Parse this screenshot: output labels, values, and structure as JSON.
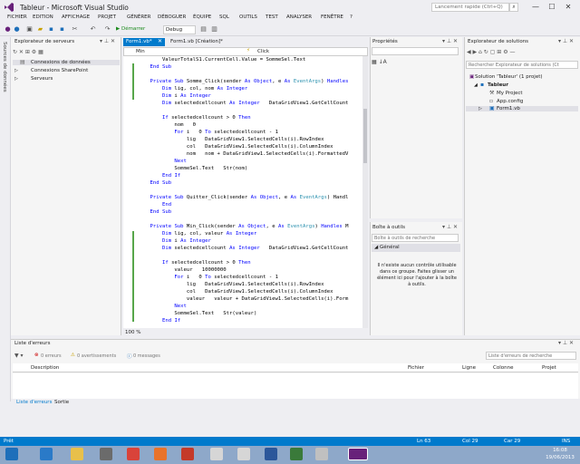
{
  "window": {
    "title": "Tableur - Microsoft Visual Studio",
    "quick_launch_placeholder": "Lancement rapide (Ctrl+Q)",
    "min": "—",
    "max": "☐",
    "close": "✕"
  },
  "menu": [
    "FICHIER",
    "EDITION",
    "AFFICHAGE",
    "PROJET",
    "GÉNÉRER",
    "DÉBOGUER",
    "ÉQUIPE",
    "SQL",
    "OUTILS",
    "TEST",
    "ANALYSER",
    "FENÊTRE",
    "?"
  ],
  "toolbar": {
    "start_label": "▶ Démarrer",
    "config": "Debug"
  },
  "left_strip_label": "Sources de données",
  "server_explorer": {
    "title": "Explorateur de serveurs",
    "items": [
      "Connexions de données",
      "Connexions SharePoint",
      "Serveurs"
    ]
  },
  "editor": {
    "tab_active": "Form1.vb*",
    "tab_other": "Form1.vb [Création]*",
    "nav_left": "Min",
    "nav_right": "Click",
    "zoom": "100 %",
    "lines": [
      "        ValeurTotalS1.CurrentCell.Value = SommeSel.Text",
      "    End Sub",
      "",
      "    Private Sub Somme_Click(sender As Object, e As EventArgs) Handles",
      "        Dim lig, col, nom As Integer",
      "        Dim i As Integer",
      "        Dim selectedcellcount As Integer   DataGridView1.GetCellCount",
      "",
      "        If selectedcellcount > 0 Then",
      "            nom   0",
      "            For i   0 To selectedcellcount - 1",
      "                lig   DataGridView1.SelectedCells(i).RowIndex",
      "                col   DataGridView1.SelectedCells(i).ColumnIndex",
      "                nom   nom + DataGridView1.SelectedCells(i).FormattedV",
      "            Next",
      "            SommeSel.Text   Str(nom)",
      "        End If",
      "    End Sub",
      "",
      "    Private Sub Quitter_Click(sender As Object, e As EventArgs) Handl",
      "        End",
      "    End Sub",
      "",
      "    Private Sub Min_Click(sender As Object, e As EventArgs) Handles M",
      "        Dim lig, col, valeur As Integer",
      "        Dim i As Integer",
      "        Dim selectedcellcount As Integer   DataGridView1.GetCellCount",
      "",
      "        If selectedcellcount > 0 Then",
      "            valeur   10000000",
      "            For i   0 To selectedcellcount - 1",
      "                lig   DataGridView1.SelectedCells(i).RowIndex",
      "                col   DataGridView1.SelectedCells(i).ColumnIndex",
      "                valeur   valeur + DataGridView1.SelectedCells(i).Form",
      "            Next",
      "            SommeSel.Text   Str(valeur)",
      "        End If"
    ]
  },
  "properties": {
    "title": "Propriétés"
  },
  "toolbox": {
    "title": "Boîte à outils",
    "search_placeholder": "Boîte à outils de recherche",
    "group": "◢ Général",
    "empty_message": "Il n'existe aucun contrôle utilisable dans ce groupe. Faites glisser un élément ici pour l'ajouter à la boîte à outils."
  },
  "solution_explorer": {
    "title": "Explorateur de solutions",
    "search_placeholder": "Rechercher Explorateur de solutions (Ct",
    "items": [
      "Solution 'Tableur' (1 projet)",
      "Tableur",
      "My Project",
      "App.config",
      "Form1.vb"
    ]
  },
  "error_list": {
    "title": "Liste d'erreurs",
    "errors": "0 erreurs",
    "warnings": "0 avertissements",
    "messages": "0 messages",
    "search_placeholder": "Liste d'erreurs de recherche",
    "columns": [
      "Description",
      "Fichier",
      "Ligne",
      "Colonne",
      "Projet"
    ],
    "tabs": [
      "Liste d'erreurs",
      "Sortie"
    ]
  },
  "status": {
    "left": "Prêt",
    "ln": "Ln 63",
    "col": "Col 29",
    "car": "Car 29",
    "mode": "INS"
  },
  "taskbar": {
    "time": "16:08",
    "date": "19/06/2013"
  }
}
